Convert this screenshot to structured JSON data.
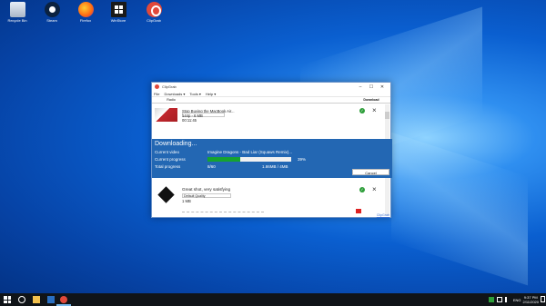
{
  "desktop": {
    "icons": [
      {
        "label": "Recycle Bin"
      },
      {
        "label": "Steam"
      },
      {
        "label": "Firefox"
      },
      {
        "label": "WinStore"
      },
      {
        "label": "ClipGrab"
      }
    ]
  },
  "window": {
    "title": "ClipGrab",
    "controls": {
      "minimize": "–",
      "maximize": "☐",
      "close": "✕"
    },
    "menu": [
      "File",
      "Downloads",
      "Tools",
      "Help"
    ],
    "tabs": {
      "tab1": "Radio",
      "tab2": "",
      "tab3": "",
      "tab4": "Download"
    },
    "downloads": [
      {
        "title": "Stop Buying the MacBook Air...",
        "format": "144p - 6 MB",
        "duration": "00:11:45"
      },
      {
        "title": "Great shot, very satisfying",
        "quality": "Default Quality",
        "size": "1 MB"
      }
    ],
    "progress": {
      "heading": "Downloading...",
      "current_video_label": "Current video",
      "current_video": "Imagine Dragons - Bad Liar (Squaws Remix)...",
      "current_progress_label": "Current progress",
      "current_percent": "39%",
      "current_fraction": 0.39,
      "total_progress_label": "Total progress",
      "total_count": "8/60",
      "total_size": "1.86MB / 4MB",
      "cancel": "Cancel"
    },
    "footer_link": "ClipGrab"
  },
  "taskbar": {
    "language": "ENG",
    "time": "9:37 PM",
    "date": "2/11/2020"
  },
  "colors": {
    "progress_panel": "#2367b3",
    "progress_fill": "#16a330",
    "taskbar": "#101418"
  }
}
